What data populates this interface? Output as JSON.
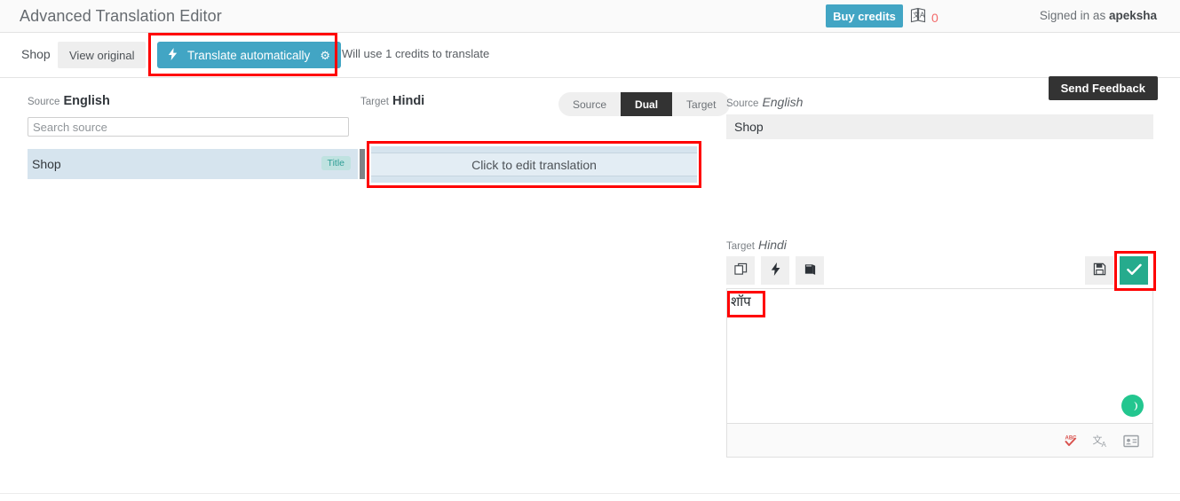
{
  "header": {
    "app_title": "Advanced Translation Editor",
    "buy_credits_label": "Buy credits",
    "credits_icon": "translate-icon",
    "credits_count": "0",
    "signed_in_prefix": "Signed in as ",
    "signed_in_user": "apeksha"
  },
  "toolbar": {
    "breadcrumb": "Shop",
    "view_original_label": "View original",
    "translate_auto_label": "Translate automatically",
    "translate_auto_icon": "lightning-bolt-icon",
    "translate_auto_settings_icon": "gear-icon",
    "credit_note": "Will use 1 credits to translate",
    "send_feedback_label": "Send Feedback"
  },
  "list_panel": {
    "source_label": "Source",
    "source_language": "English",
    "target_label": "Target",
    "target_language": "Hindi",
    "search_placeholder": "Search source",
    "search_value": "",
    "view_modes": [
      {
        "label": "Source",
        "active": false
      },
      {
        "label": "Dual",
        "active": true
      },
      {
        "label": "Target",
        "active": false
      }
    ],
    "rows": [
      {
        "source_text": "Shop",
        "badge": "Title",
        "target_placeholder": "Click to edit translation"
      }
    ]
  },
  "editor_panel": {
    "source_label": "Source",
    "source_language": "English",
    "source_text": "Shop",
    "target_label": "Target",
    "target_language": "Hindi",
    "target_text": "शॉप",
    "toolbar_left": [
      {
        "name": "copy-source-icon",
        "title": "Copy source"
      },
      {
        "name": "lightning-bolt-icon",
        "title": "Machine translate"
      },
      {
        "name": "glossary-book-icon",
        "title": "Glossary"
      }
    ],
    "toolbar_right": [
      {
        "name": "save-icon",
        "title": "Save"
      },
      {
        "name": "check-icon",
        "title": "Save and continue"
      }
    ],
    "footer_icons": [
      {
        "name": "spellcheck-icon",
        "title": "Spell check"
      },
      {
        "name": "translate-icon",
        "title": "Translate"
      },
      {
        "name": "id-card-icon",
        "title": "Details"
      }
    ],
    "status_icon": "loading-spinner-icon"
  },
  "colors": {
    "accent_blue": "#42a5c4",
    "accent_green": "#26ab8d",
    "spinner_green": "#23c68f",
    "dark": "#333333",
    "row_highlight": "#d6e4ee",
    "badge_teal": "#2e9e95",
    "credits_red": "#f36a6a",
    "annotation_red": "#ff0000"
  }
}
